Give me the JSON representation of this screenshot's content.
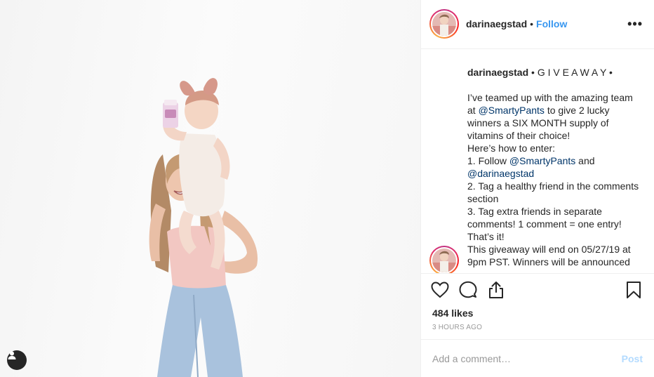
{
  "header": {
    "username": "darinaegstad",
    "separator": "•",
    "follow_label": "Follow",
    "more_label": "•••"
  },
  "caption": {
    "username": "darinaegstad",
    "title": "• G I V E A W A Y •",
    "line1_prefix": "I’ve teamed up with the amazing team at ",
    "mention_smartypants": "@SmartyPants",
    "line1_suffix": " to give 2 lucky winners a SIX MONTH supply of vitamins of their choice!",
    "how_to_enter": "Here’s how to enter:",
    "step1_prefix": "1. Follow ",
    "step1_and": " and ",
    "mention_darina": "@darinaegstad",
    "step2": "2. Tag a healthy friend in the comments section",
    "step3": "3. Tag extra friends in separate comments! 1 comment = one entry! That’s it!",
    "ending": "This giveaway will end on 05/27/19 at 9pm PST. Winners will be announced"
  },
  "likes": "484 likes",
  "timestamp": "3 HOURS AGO",
  "comment_box": {
    "placeholder": "Add a comment…",
    "post_label": "Post"
  },
  "icons": {
    "like": "heart-icon",
    "comment": "speech-bubble-icon",
    "share": "share-icon",
    "save": "bookmark-icon",
    "more": "more-options-icon",
    "tag": "user-tag-icon"
  },
  "colors": {
    "follow": "#3897f0",
    "mention": "#003569",
    "post_disabled": "#b3dbff",
    "muted": "#999999"
  }
}
